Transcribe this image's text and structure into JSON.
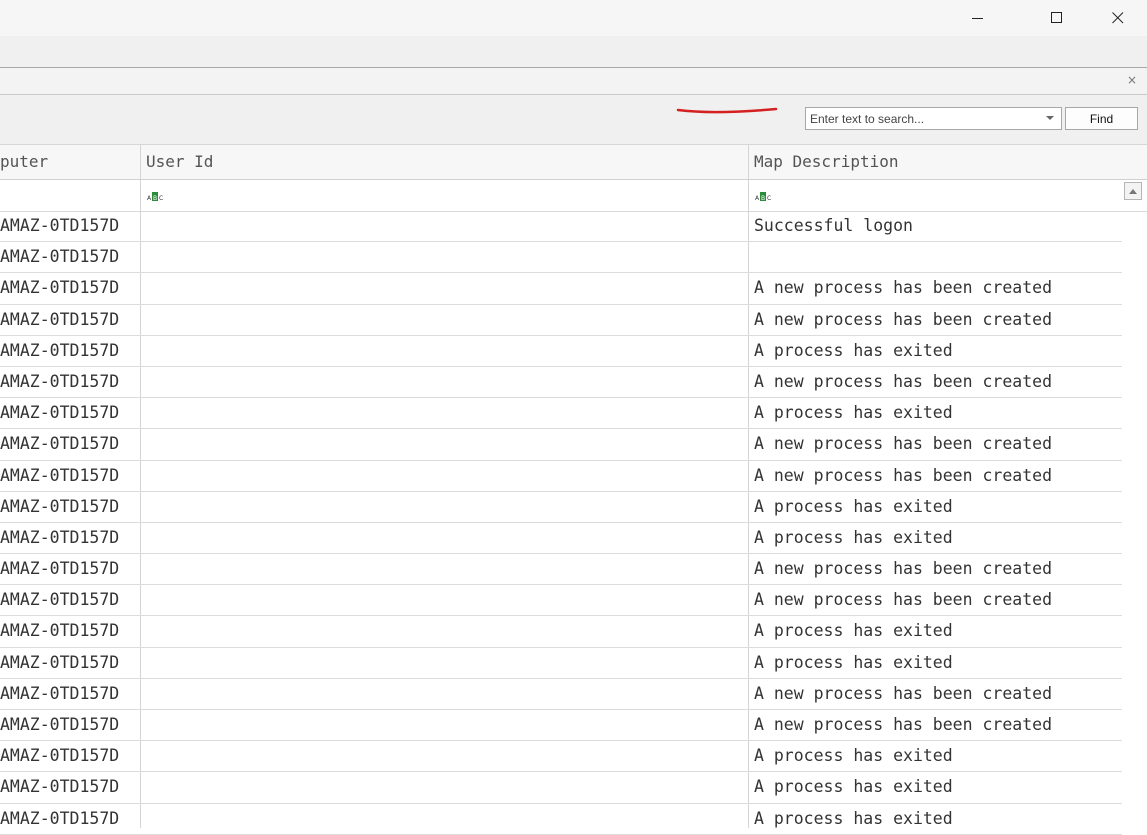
{
  "window": {
    "controls": {
      "minimize_icon": "minimize-icon",
      "maximize_icon": "maximize-icon",
      "close_icon": "close-icon"
    }
  },
  "tabstrip": {
    "close_glyph": "×"
  },
  "toolbar": {
    "search_placeholder": "Enter text to search...",
    "find_label": "Find"
  },
  "grid": {
    "columns": [
      {
        "key": "computer",
        "label": "puter"
      },
      {
        "key": "user_id",
        "label": "User Id"
      },
      {
        "key": "map_description",
        "label": "Map Description"
      }
    ],
    "rows": [
      {
        "computer": "AMAZ-0TD157D",
        "user_id": "",
        "map_description": "Successful logon"
      },
      {
        "computer": "AMAZ-0TD157D",
        "user_id": "",
        "map_description": ""
      },
      {
        "computer": "AMAZ-0TD157D",
        "user_id": "",
        "map_description": "A new process has been created"
      },
      {
        "computer": "AMAZ-0TD157D",
        "user_id": "",
        "map_description": "A new process has been created"
      },
      {
        "computer": "AMAZ-0TD157D",
        "user_id": "",
        "map_description": "A process has exited"
      },
      {
        "computer": "AMAZ-0TD157D",
        "user_id": "",
        "map_description": "A new process has been created"
      },
      {
        "computer": "AMAZ-0TD157D",
        "user_id": "",
        "map_description": "A process has exited"
      },
      {
        "computer": "AMAZ-0TD157D",
        "user_id": "",
        "map_description": "A new process has been created"
      },
      {
        "computer": "AMAZ-0TD157D",
        "user_id": "",
        "map_description": "A new process has been created"
      },
      {
        "computer": "AMAZ-0TD157D",
        "user_id": "",
        "map_description": "A process has exited"
      },
      {
        "computer": "AMAZ-0TD157D",
        "user_id": "",
        "map_description": "A process has exited"
      },
      {
        "computer": "AMAZ-0TD157D",
        "user_id": "",
        "map_description": "A new process has been created"
      },
      {
        "computer": "AMAZ-0TD157D",
        "user_id": "",
        "map_description": "A new process has been created"
      },
      {
        "computer": "AMAZ-0TD157D",
        "user_id": "",
        "map_description": "A process has exited"
      },
      {
        "computer": "AMAZ-0TD157D",
        "user_id": "",
        "map_description": "A process has exited"
      },
      {
        "computer": "AMAZ-0TD157D",
        "user_id": "",
        "map_description": "A new process has been created"
      },
      {
        "computer": "AMAZ-0TD157D",
        "user_id": "",
        "map_description": "A new process has been created"
      },
      {
        "computer": "AMAZ-0TD157D",
        "user_id": "",
        "map_description": "A process has exited"
      },
      {
        "computer": "AMAZ-0TD157D",
        "user_id": "",
        "map_description": "A process has exited"
      },
      {
        "computer": "AMAZ-0TD157D",
        "user_id": "",
        "map_description": "A process has exited"
      }
    ]
  },
  "colors": {
    "accent_red_mark": "#d42020",
    "filter_icon_green": "#2e8b3a"
  }
}
